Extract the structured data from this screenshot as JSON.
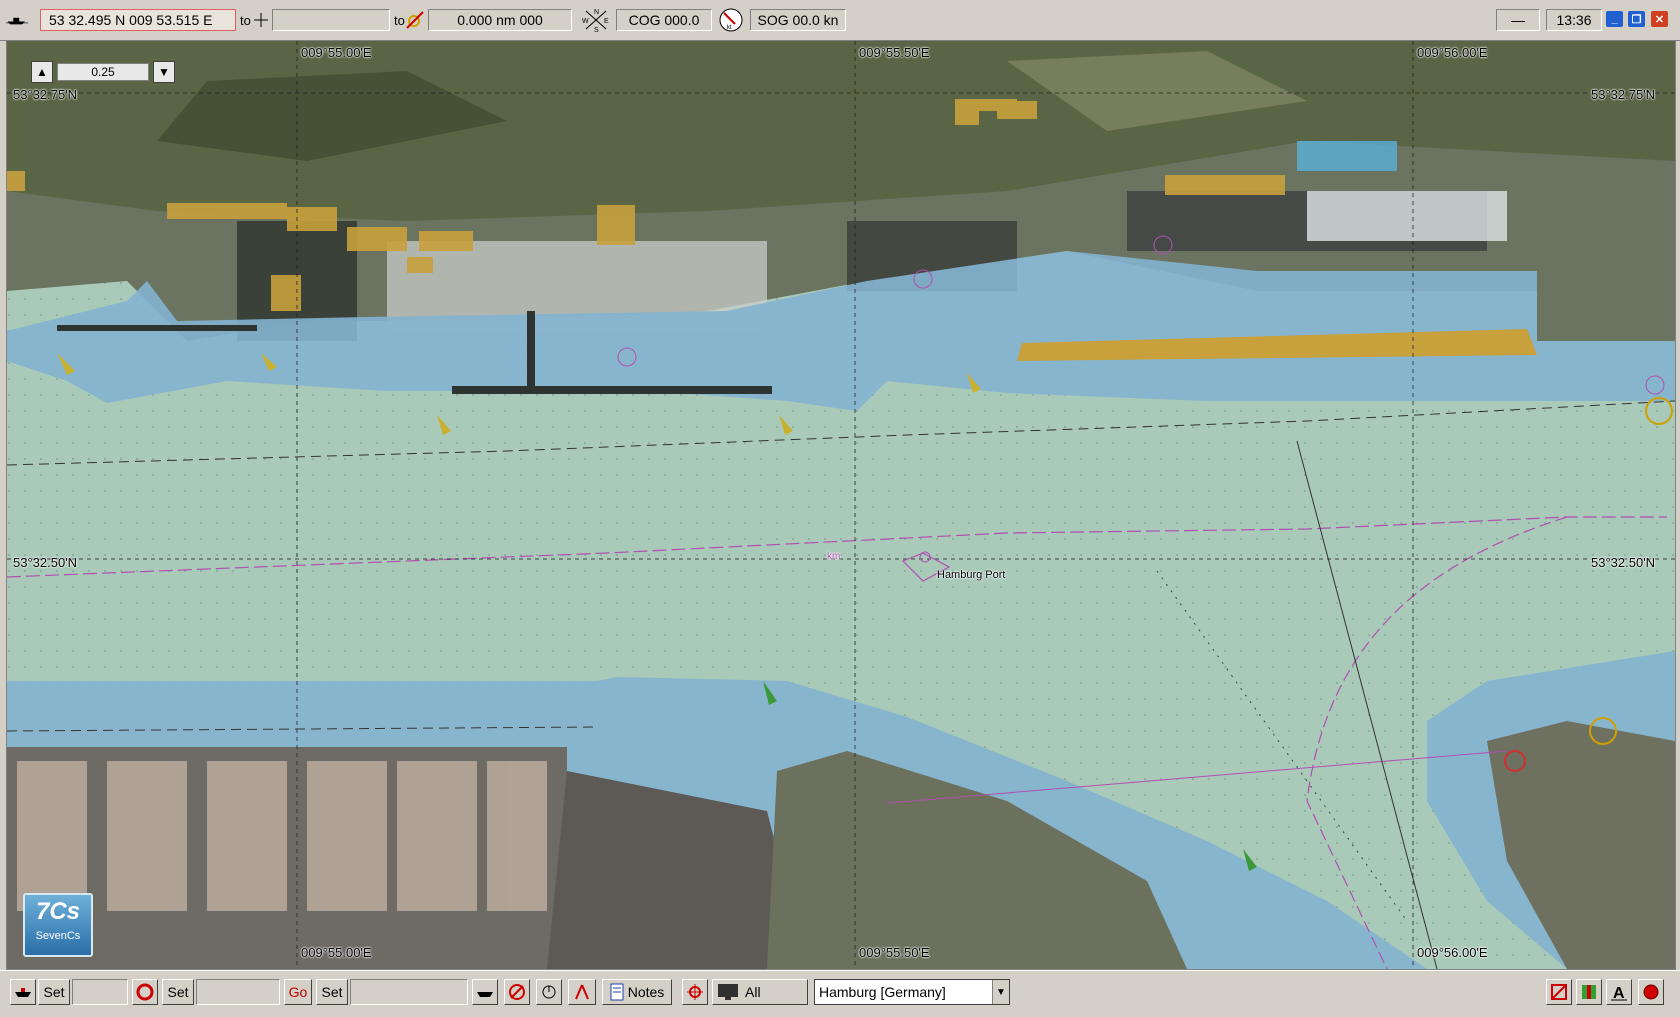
{
  "topbar": {
    "position": "53 32.495 N   009 53.515 E",
    "to_label": "to",
    "to_value": "",
    "to_label2": "to",
    "distance": "0.000 nm  000",
    "cog": "COG 000.0",
    "sog": "SOG 00.0 kn",
    "compass_n": "N",
    "compass_s": "S",
    "compass_w": "W",
    "compass_e": "E",
    "speed_unit": "kt",
    "time": "13:36"
  },
  "map": {
    "zoom_value": "0.25",
    "lon_labels": [
      "009°55.00'E",
      "009°55.50'E",
      "009°56.00'E"
    ],
    "lat_labels": [
      "53°32.75'N",
      "53°32.50'N"
    ],
    "place_label": "Hamburg Port",
    "km_label": "km",
    "logo_text": "7Cs",
    "logo_subtext": "SevenCs"
  },
  "bottombar": {
    "set_label_1": "Set",
    "set_label_2": "Set",
    "go_label": "Go",
    "set_label_3": "Set",
    "notes_label": "Notes",
    "all_label": "All",
    "region": "Hamburg [Germany]"
  },
  "colors": {
    "deep_water": "#a9c9b9",
    "shallow_water": "#84b2d0",
    "land_yellow": "#c8a03c",
    "route_magenta": "#b050b0"
  }
}
